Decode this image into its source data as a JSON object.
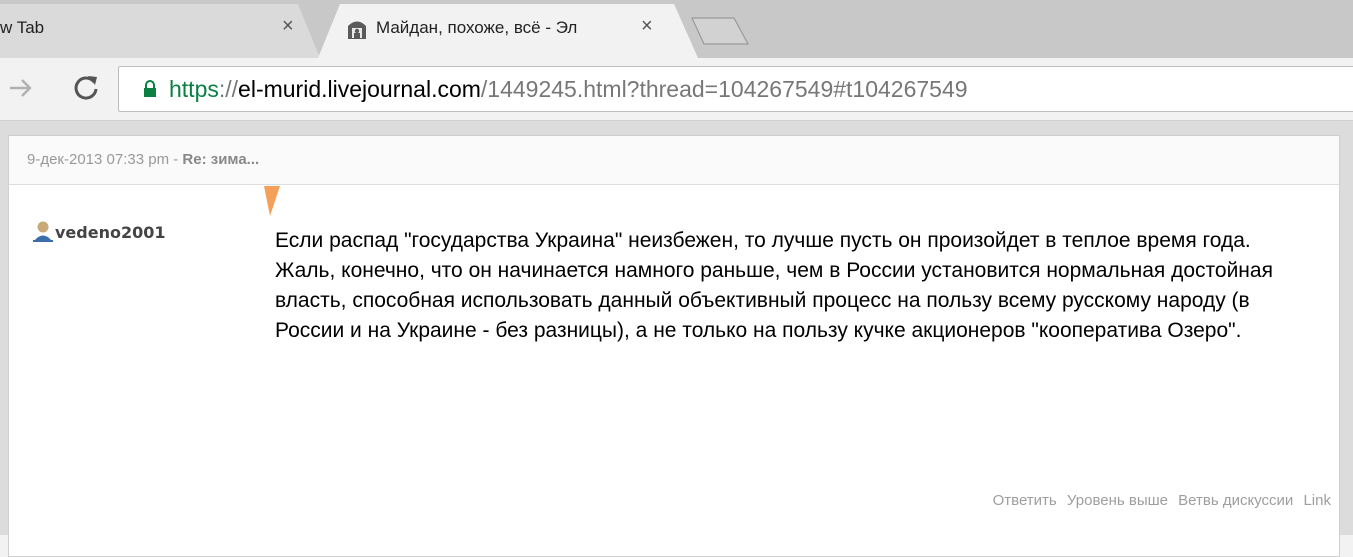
{
  "browser": {
    "tabs": [
      {
        "title": "w Tab"
      },
      {
        "title": "Майдан, похоже, всё - Эл"
      }
    ],
    "close_glyph": "×",
    "url": {
      "scheme": "https",
      "separator": "://",
      "host": "el-murid.livejournal.com",
      "path": "/1449245.html?thread=104267549#t104267549"
    }
  },
  "comment": {
    "date": "9-дек-2013 07:33 pm - ",
    "subject": "Re: зима...",
    "username": "vedeno2001",
    "text": "Если распад \"государства Украина\" неизбежен, то лучше пусть он произойдет в теплое время года. Жаль, конечно, что он начинается намного раньше, чем в России установится нормальная достойная власть, способная использовать данный объективный процесс на пользу всему русскому народу (в России и на Украине - без разницы), а не только на пользу кучке акционеров \"кооператива Озеро\".",
    "actions": {
      "reply": "Ответить",
      "parent": "Уровень выше",
      "thread": "Ветвь дискуссии",
      "link": "Link"
    }
  },
  "colors": {
    "secure_green": "#0b8043",
    "flag_orange": "#f5a05a",
    "user_icon_blue": "#3b6ea8"
  },
  "icons": [
    "favicon-icon",
    "close-icon",
    "forward-arrow-icon",
    "reload-icon",
    "lock-icon",
    "user-icon",
    "new-tab-icon"
  ]
}
